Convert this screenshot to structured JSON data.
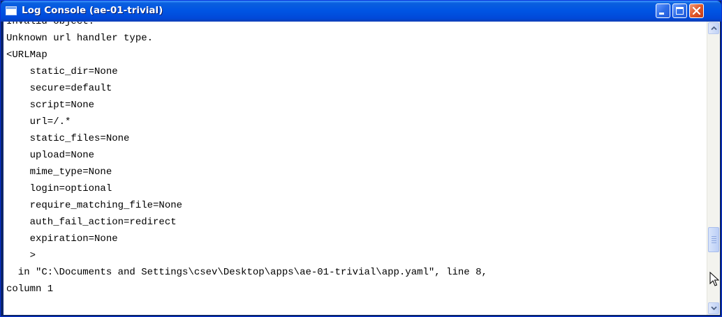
{
  "window": {
    "title": "Log Console (ae-01-trivial)"
  },
  "log": {
    "lines": [
      "Invalid object:",
      "Unknown url handler type.",
      "<URLMap",
      "    static_dir=None",
      "    secure=default",
      "    script=None",
      "    url=/.*",
      "    static_files=None",
      "    upload=None",
      "    mime_type=None",
      "    login=optional",
      "    require_matching_file=None",
      "    auth_fail_action=redirect",
      "    expiration=None",
      "    >",
      "  in \"C:\\Documents and Settings\\csev\\Desktop\\apps\\ae-01-trivial\\app.yaml\", line 8,",
      "column 1"
    ]
  },
  "icons": {
    "app": "console-window-icon",
    "minimize": "minimize-icon",
    "maximize": "maximize-icon",
    "close": "close-icon",
    "scroll_up": "chevron-up-icon",
    "scroll_down": "chevron-down-icon",
    "cursor": "mouse-pointer-icon"
  },
  "colors": {
    "titlebar": "#0054e3",
    "close_button": "#e0582a",
    "text": "#000000",
    "background": "#ffffff"
  }
}
